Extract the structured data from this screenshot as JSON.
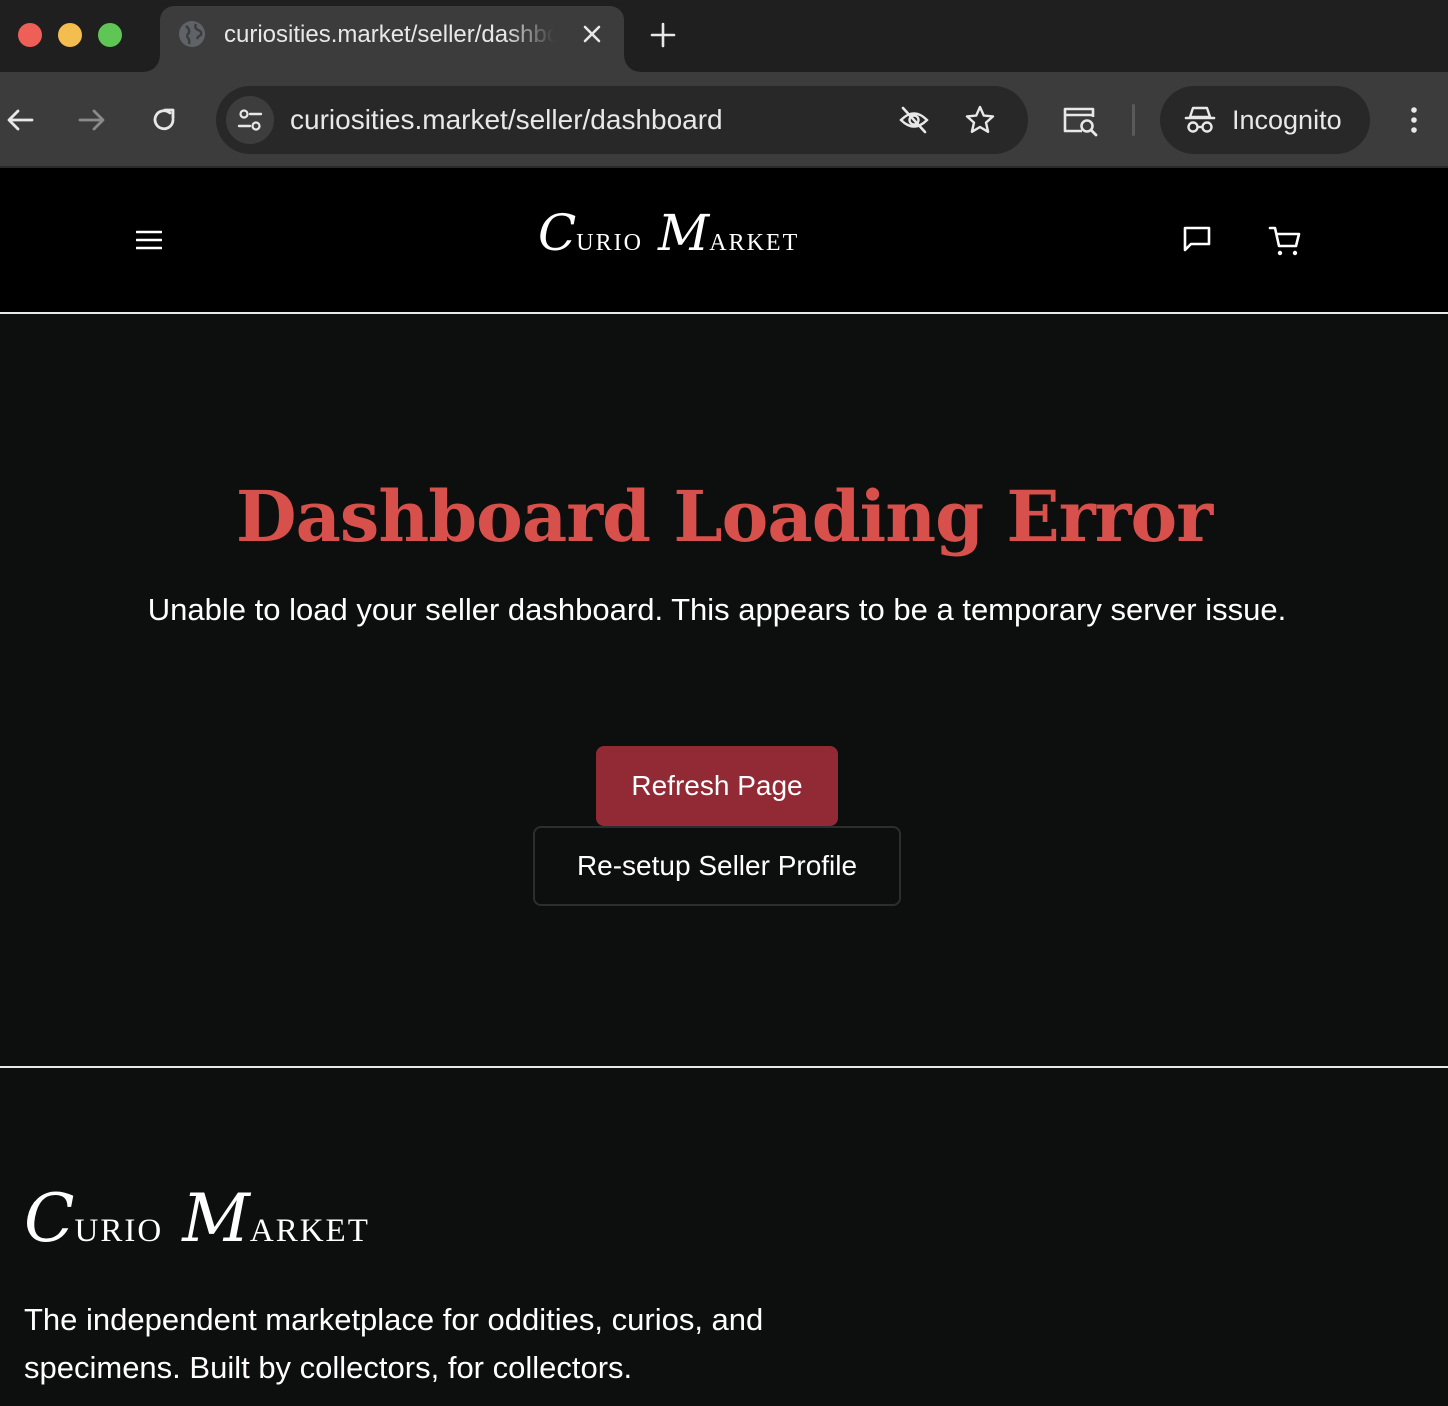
{
  "browser": {
    "tab_title": "curiosities.market/seller/dashboard",
    "url": "curiosities.market/seller/dashboard",
    "incognito_label": "Incognito",
    "icons": [
      "globe-icon",
      "close-icon",
      "plus-icon",
      "back-icon",
      "forward-icon",
      "reload-icon",
      "site-info-icon",
      "eye-off-icon",
      "star-icon",
      "page-search-icon",
      "incognito-icon",
      "more-vert-icon"
    ]
  },
  "header": {
    "logo": {
      "cap1": "C",
      "rest1": "URIO",
      "cap2": "M",
      "rest2": "ARKET"
    },
    "icons": [
      "menu-icon",
      "chat-icon",
      "cart-icon"
    ]
  },
  "main": {
    "title": "Dashboard Loading Error",
    "message": "Unable to load your seller dashboard. This appears to be a temporary server issue.",
    "primary_button": "Refresh Page",
    "secondary_button": "Re-setup Seller Profile"
  },
  "footer": {
    "logo": {
      "cap1": "C",
      "rest1": "URIO",
      "cap2": "M",
      "rest2": "ARKET"
    },
    "tagline": "The independent marketplace for oddities, curios, and specimens. Built by collectors, for collectors."
  },
  "colors": {
    "error_title": "#d8504b",
    "primary_button_bg": "#922a36",
    "page_bg": "#0d0e0e",
    "header_bg": "#000000"
  }
}
